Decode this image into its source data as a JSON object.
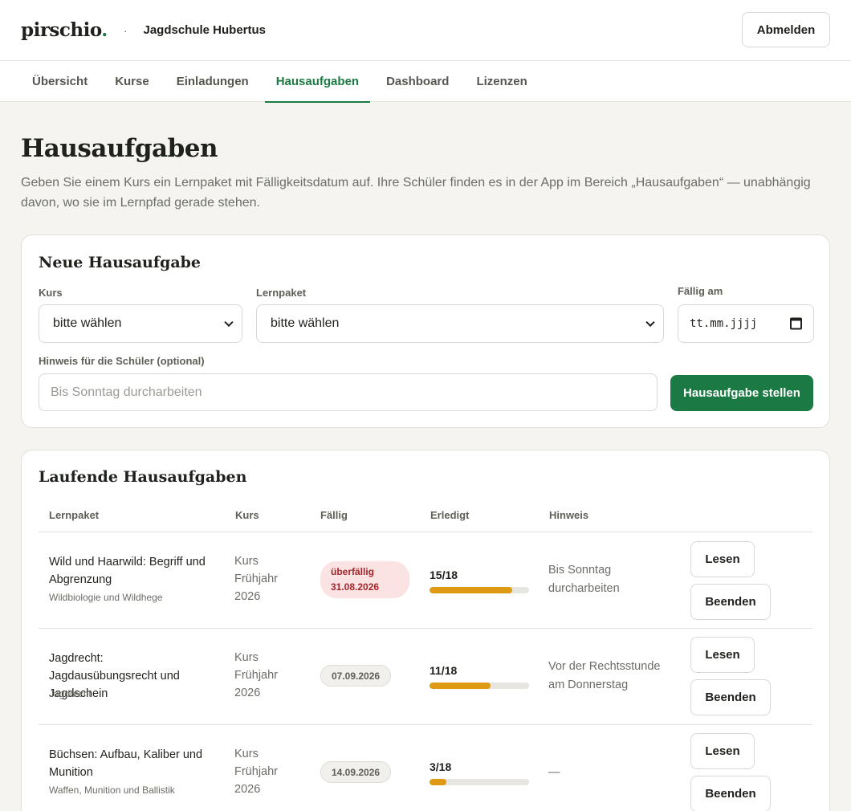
{
  "header": {
    "logo_text": "pirschio",
    "logo_dot": ".",
    "separator": "·",
    "school_name": "Jagdschule Hubertus",
    "logout_label": "Abmelden"
  },
  "nav": {
    "tabs": [
      {
        "label": "Übersicht"
      },
      {
        "label": "Kurse"
      },
      {
        "label": "Einladungen"
      },
      {
        "label": "Hausaufgaben"
      },
      {
        "label": "Dashboard"
      },
      {
        "label": "Lizenzen"
      }
    ],
    "active": "Hausaufgaben"
  },
  "page": {
    "title": "Hausaufgaben",
    "description": "Geben Sie einem Kurs ein Lernpaket mit Fälligkeitsdatum auf. Ihre Schüler finden es in der App im Bereich „Hausaufgaben“ — unabhängig davon, wo sie im Lernpfad gerade stehen."
  },
  "form": {
    "title": "Neue Hausaufgabe",
    "course_label": "Kurs",
    "course_value": "bitte wählen",
    "package_label": "Lernpaket",
    "package_value": "bitte wählen",
    "due_label": "Fällig am",
    "due_placeholder": "tt.mm.jjjj",
    "hint_label": "Hinweis für die Schüler (optional)",
    "hint_placeholder": "Bis Sonntag durcharbeiten",
    "submit_label": "Hausaufgabe stellen"
  },
  "table": {
    "title": "Laufende Hausaufgaben",
    "columns": [
      "Lernpaket",
      "Kurs",
      "Fällig",
      "Erledigt",
      "Hinweis"
    ],
    "rows": [
      {
        "package": "Wild und Haarwild: Begriff und Abgrenzung",
        "category": "Wildbiologie und Wildhege",
        "course": "Kurs Frühjahr 2026",
        "due_status": "überfällig",
        "due_date": "31.08.2026",
        "overdue": true,
        "done_label": "15/18",
        "done": 15,
        "total": 18,
        "hint": "Bis Sonntag durcharbeiten",
        "read_label": "Lesen",
        "end_label": "Beenden"
      },
      {
        "package": "Jagdrecht: Jagdausübungsrecht und Jagdschein",
        "category": "Jagdrecht",
        "course": "Kurs Frühjahr 2026",
        "due_status": "",
        "due_date": "07.09.2026",
        "overdue": false,
        "done_label": "11/18",
        "done": 11,
        "total": 18,
        "hint": "Vor der Rechtsstunde am Donnerstag",
        "read_label": "Lesen",
        "end_label": "Beenden"
      },
      {
        "package": "Büchsen: Aufbau, Kaliber und Munition",
        "category": "Waffen, Munition und Ballistik",
        "course": "Kurs Frühjahr 2026",
        "due_status": "",
        "due_date": "14.09.2026",
        "overdue": false,
        "done_label": "3/18",
        "done": 3,
        "total": 18,
        "hint": "—",
        "read_label": "Lesen",
        "end_label": "Beenden"
      }
    ]
  },
  "colors": {
    "brand": "#1b7a43",
    "progress": "#dd9a12",
    "overdue_bg": "#fbe3e3",
    "overdue_text": "#a3262a"
  }
}
